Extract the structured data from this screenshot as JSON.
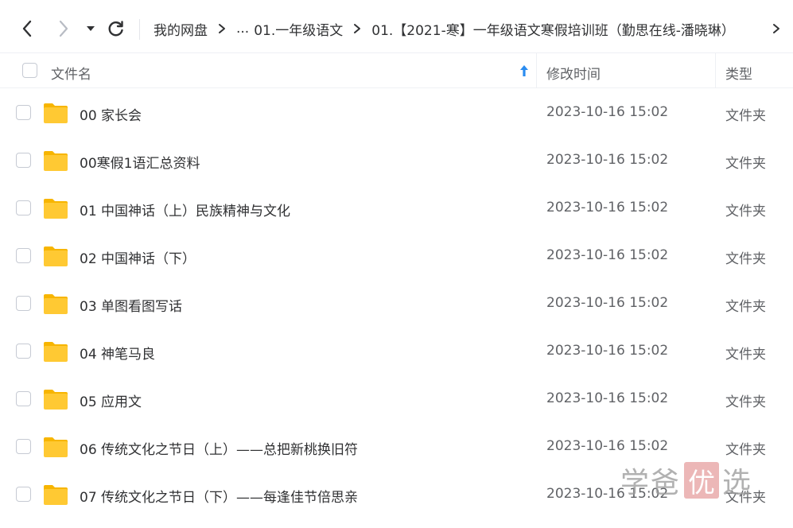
{
  "nav": {
    "back_icon": "chevron-left-icon",
    "forward_icon": "chevron-right-icon",
    "dropdown_icon": "caret-down-icon",
    "refresh_icon": "refresh-icon"
  },
  "breadcrumb": {
    "root": "我的网盘",
    "ellipsis": "...",
    "items": [
      "01.一年级语文",
      "01.【2021-寒】一年级语文寒假培训班（勤思在线-潘晓琳）"
    ]
  },
  "header": {
    "name_label": "文件名",
    "time_label": "修改时间",
    "type_label": "类型",
    "sort_icon": "sort-ascending-arrow-icon"
  },
  "files": [
    {
      "name": "00 家长会",
      "modified": "2023-10-16 15:02",
      "type": "文件夹"
    },
    {
      "name": "00寒假1语汇总资料",
      "modified": "2023-10-16 15:02",
      "type": "文件夹"
    },
    {
      "name": "01 中国神话（上）民族精神与文化",
      "modified": "2023-10-16 15:02",
      "type": "文件夹"
    },
    {
      "name": "02 中国神话（下）",
      "modified": "2023-10-16 15:02",
      "type": "文件夹"
    },
    {
      "name": "03 单图看图写话",
      "modified": "2023-10-16 15:02",
      "type": "文件夹"
    },
    {
      "name": "04 神笔马良",
      "modified": "2023-10-16 15:02",
      "type": "文件夹"
    },
    {
      "name": "05 应用文",
      "modified": "2023-10-16 15:02",
      "type": "文件夹"
    },
    {
      "name": "06 传统文化之节日（上）——总把新桃换旧符",
      "modified": "2023-10-16 15:02",
      "type": "文件夹"
    },
    {
      "name": "07 传统文化之节日（下）——每逢佳节倍思亲",
      "modified": "2023-10-16 15:02",
      "type": "文件夹"
    }
  ],
  "watermark": {
    "part1": "学爸",
    "part2": "优",
    "part3": "选"
  },
  "colors": {
    "folder": "#ffc933",
    "folder_tab": "#f7b500",
    "sort_arrow": "#2a8cf0",
    "watermark_box": "#e7a4a4"
  }
}
